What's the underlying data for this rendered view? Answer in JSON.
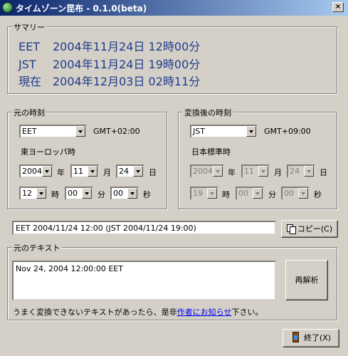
{
  "window": {
    "title": "タイムゾーン昆布 - 0.1.0(beta)",
    "close_label": "×"
  },
  "summary": {
    "legend": "サマリー",
    "lines": [
      {
        "label": "EET",
        "value": "2004年11月24日 12時00分"
      },
      {
        "label": "JST",
        "value": "2004年11月24日 19時00分"
      },
      {
        "label": "現在",
        "value": "2004年12月03日 02時11分"
      }
    ]
  },
  "source": {
    "legend": "元の時刻",
    "timezone": "EET",
    "offset": "GMT+02:00",
    "tz_name": "東ヨーロッパ時",
    "year": "2004",
    "year_unit": "年",
    "month": "11",
    "month_unit": "月",
    "day": "24",
    "day_unit": "日",
    "hour": "12",
    "hour_unit": "時",
    "minute": "00",
    "minute_unit": "分",
    "second": "00",
    "second_unit": "秒"
  },
  "target": {
    "legend": "変換後の時刻",
    "timezone": "JST",
    "offset": "GMT+09:00",
    "tz_name": "日本標準時",
    "year": "2004",
    "year_unit": "年",
    "month": "11",
    "month_unit": "月",
    "day": "24",
    "day_unit": "日",
    "hour": "19",
    "hour_unit": "時",
    "minute": "00",
    "minute_unit": "分",
    "second": "00",
    "second_unit": "秒"
  },
  "result": {
    "text": "EET 2004/11/24 12:00 (JST 2004/11/24 19:00)",
    "copy_label": "コピー(C)"
  },
  "source_text": {
    "legend": "元のテキスト",
    "value": "Nov 24, 2004 12:00:00 EET",
    "reparse_label": "再解析",
    "note_before": "うまく変換できないテキストがあったら、是非",
    "note_link": "作者にお知らせ",
    "note_after": "下さい。"
  },
  "footer": {
    "exit_label": "終了(X)"
  }
}
